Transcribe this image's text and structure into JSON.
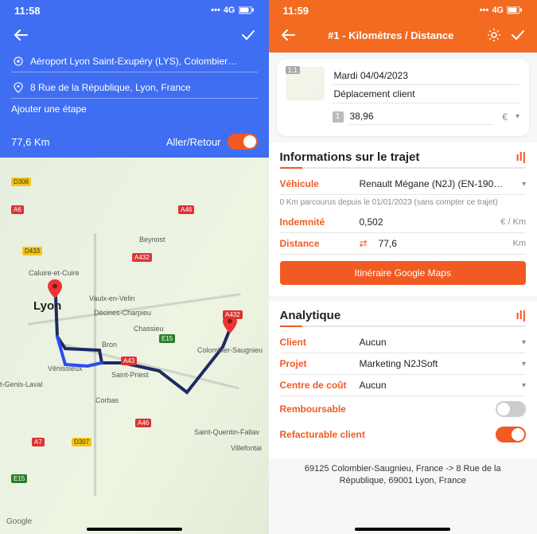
{
  "left": {
    "status": {
      "time": "11:58",
      "network": "4G"
    },
    "origin": "Aéroport Lyon Saint-Exupéry (LYS), Colombier…",
    "destination": "8 Rue de la République, Lyon, France",
    "add_step": "Ajouter une étape",
    "distance": "77,6 Km",
    "roundtrip_label": "Aller/Retour",
    "roundtrip_on": true,
    "map": {
      "city_main": "Lyon",
      "labels": [
        "Caluire-et-Cuire",
        "Vaulx-en-Velin",
        "Décines-Charpieu",
        "Chassieu",
        "Colombier-Saugnieu",
        "Bron",
        "Vénissieux",
        "Saint-Priest",
        "Corbas",
        "Beynost",
        "Villefontai",
        "Saint-Quentin-Fallav",
        "t-Genis-Laval"
      ],
      "road_tags": [
        {
          "t": "A46",
          "c": "red"
        },
        {
          "t": "A432",
          "c": "red"
        },
        {
          "t": "A432",
          "c": "red"
        },
        {
          "t": "A6",
          "c": "red"
        },
        {
          "t": "A43",
          "c": "red"
        },
        {
          "t": "A46",
          "c": "red"
        },
        {
          "t": "A7",
          "c": "red"
        },
        {
          "t": "D433",
          "c": "yellow"
        },
        {
          "t": "D306",
          "c": "yellow"
        },
        {
          "t": "D307",
          "c": "yellow"
        },
        {
          "t": "E15",
          "c": "green"
        },
        {
          "t": "E15",
          "c": "green"
        }
      ],
      "attribution": "Google"
    }
  },
  "right": {
    "status": {
      "time": "11:59",
      "network": "4G"
    },
    "header_title": "#1 - Kilomètres / Distance",
    "card": {
      "thumb_badge": "1:1",
      "date": "Mardi 04/04/2023",
      "category": "Déplacement client",
      "step_num": "1",
      "amount": "38,96",
      "currency": "€"
    },
    "trip": {
      "title": "Informations sur le trajet",
      "vehicle_label": "Véhicule",
      "vehicle_value": "Renault  Mégane (N2J) (EN-190…",
      "note": "0 Km parcourus depuis le 01/01/2023 (sans compter ce trajet)",
      "indemnite_label": "Indemnité",
      "indemnite_value": "0,502",
      "indemnite_unit": "€ / Km",
      "distance_label": "Distance",
      "distance_value": "77,6",
      "distance_unit": "Km",
      "map_button": "Itinéraire Google Maps"
    },
    "analytics": {
      "title": "Analytique",
      "client_label": "Client",
      "client_value": "Aucun",
      "project_label": "Projet",
      "project_value": "Marketing N2JSoft",
      "cost_label": "Centre de coût",
      "cost_value": "Aucun",
      "reimbursable_label": "Remboursable",
      "reimbursable_on": false,
      "billable_label": "Refacturable client",
      "billable_on": true
    },
    "route_text": "69125 Colombier-Saugnieu, France -> 8 Rue de la République, 69001 Lyon, France"
  }
}
